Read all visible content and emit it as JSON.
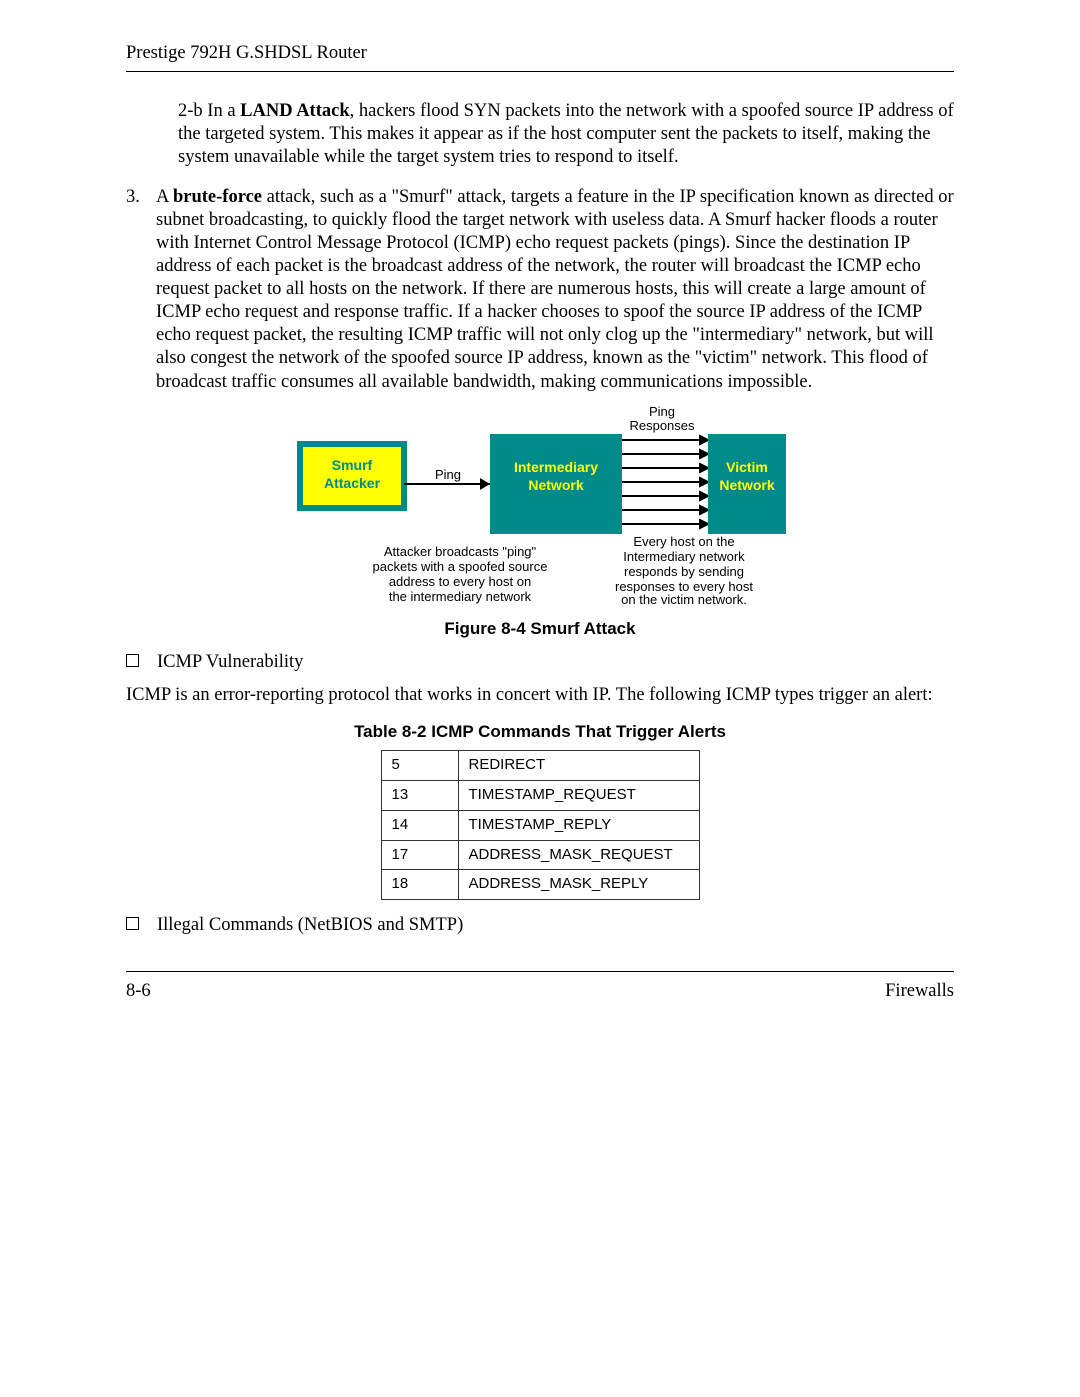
{
  "header": {
    "title": "Prestige 792H G.SHDSL Router"
  },
  "para2b": {
    "prefix": "2-b  In a ",
    "bold": "LAND Attack",
    "rest": ", hackers flood SYN packets into the network with a spoofed source IP address of the targeted system. This makes it appear as if the host computer sent the packets to itself, making the system unavailable while the target system tries to respond to itself."
  },
  "item3": {
    "num": "3.",
    "pre": "A ",
    "bold": "brute-force",
    "post": " attack, such as a \"Smurf\" attack, targets a feature in the IP specification known as directed or subnet broadcasting, to quickly flood the target network with useless data. A Smurf hacker floods a router with Internet Control Message Protocol (ICMP) echo request packets (pings). Since the destination IP address of each packet is the broadcast address of the network, the router will broadcast the ICMP echo request packet to all hosts on the network. If there are numerous hosts, this will create a large amount of ICMP echo request and response traffic. If a hacker chooses to spoof the source IP address of the ICMP echo request packet, the resulting ICMP traffic will not only clog up the \"intermediary\" network, but will also congest the network of the spoofed source IP address, known as the \"victim\" network. This flood of broadcast traffic consumes all available bandwidth, making communications impossible."
  },
  "diagram": {
    "ping_responses": "Ping\nResponses",
    "smurf_attacker": "Smurf\nAttacker",
    "intermediary": "Intermediary\nNetwork",
    "victim_network": "Victim\nNetwork",
    "ping_label": "Ping",
    "legend_left": "Attacker broadcasts \"ping\"\npackets with a spoofed source\naddress to every host on\nthe intermediary network",
    "legend_right": "Every host on the\nIntermediary network\nresponds by sending\nresponses to every host\non the victim network."
  },
  "figure_caption": "Figure 8-4 Smurf Attack",
  "bullets": {
    "icmp_vuln": "ICMP Vulnerability",
    "illegal_cmds": "Illegal Commands (NetBIOS and SMTP)"
  },
  "icmp_line": "ICMP is an error-reporting protocol that works in concert with IP. The following ICMP types trigger an alert:",
  "table_caption": "Table 8-2 ICMP Commands That Trigger Alerts",
  "icmp_table": [
    {
      "code": "5",
      "name": "REDIRECT"
    },
    {
      "code": "13",
      "name": "TIMESTAMP_REQUEST"
    },
    {
      "code": "14",
      "name": "TIMESTAMP_REPLY"
    },
    {
      "code": "17",
      "name": "ADDRESS_MASK_REQUEST"
    },
    {
      "code": "18",
      "name": "ADDRESS_MASK_REPLY"
    }
  ],
  "footer": {
    "left": "8-6",
    "right": "Firewalls"
  },
  "colors": {
    "teal": "#008a8a",
    "yellow": "#ffff00",
    "black": "#000000"
  }
}
